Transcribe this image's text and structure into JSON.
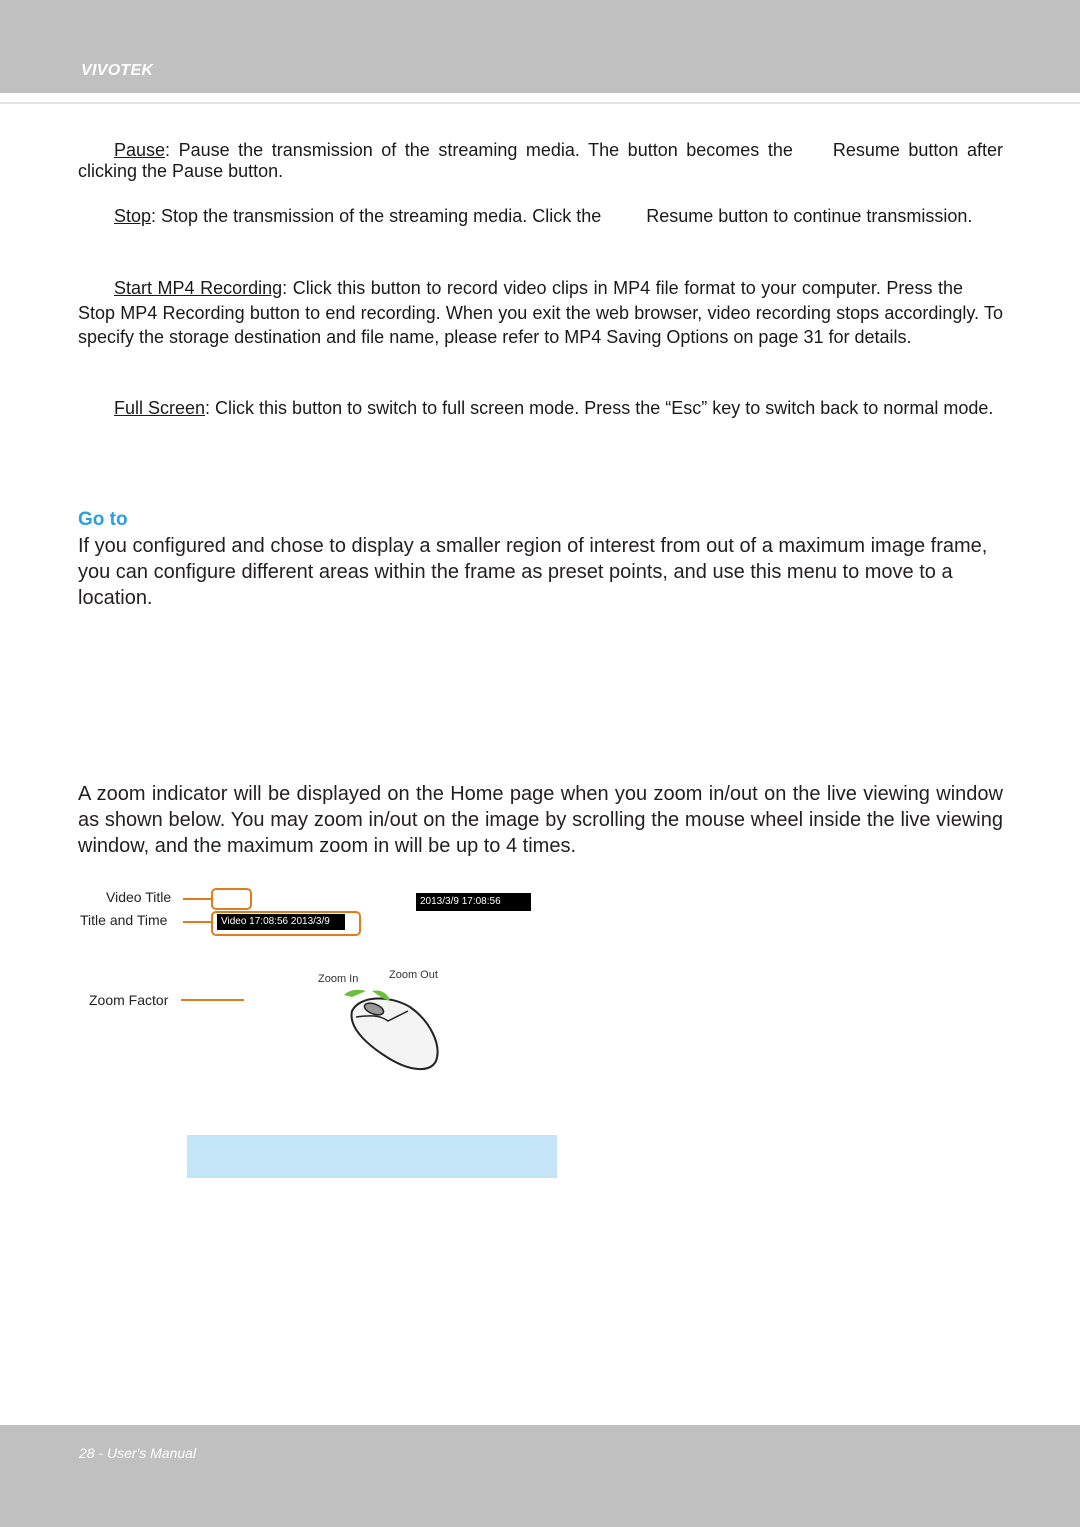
{
  "header": {
    "brand": "VIVOTEK"
  },
  "items": [
    {
      "term": "Pause",
      "text_a": ": Pause the transmission of the streaming media. The button becomes the",
      "text_b": "Resume button after clicking the Pause button."
    },
    {
      "term": "Stop",
      "text_a": ": Stop the transmission of the streaming media. Click the",
      "text_b": "Resume button to continue transmission."
    },
    {
      "term": "Start MP4 Recording",
      "text_a": ": Click this button to record video clips in MP4 file format to your computer. Press the",
      "text_b": "Stop MP4 Recording button to end recording. When you exit the web browser, video recording stops accordingly. To specify the storage destination and file name, please refer to MP4 Saving Options on page 31 for details."
    },
    {
      "term": "Full Screen",
      "text_a": ": Click this button to switch to full screen mode. Press the “Esc” key to switch back to normal mode."
    }
  ],
  "goto": {
    "heading": "Go to",
    "body": "If you configured and chose to display a smaller region of interest from out of a maximum image frame, you can configure different areas within the frame as preset points, and use this menu to move to a location."
  },
  "zoom_para": "A zoom indicator will be displayed on the Home page when you zoom in/out on the live viewing window as shown below. You may zoom in/out on the image by scrolling the mouse wheel inside the live viewing window, and the maximum zoom in will be up to 4 times.",
  "figure": {
    "labels": {
      "video_title": "Video Title",
      "title_and_time": "Title and Time",
      "zoom_factor": "Zoom Factor"
    },
    "title_time_overlay": "Video 17:08:56  2013/3/9",
    "time_overlay": "2013/3/9  17:08:56",
    "mouse": {
      "zoom_in": "Zoom In",
      "zoom_out": "Zoom Out"
    },
    "accent_color": "#e07b1e",
    "arrow_color": "#6cbf3c"
  },
  "footer": {
    "text": "28 - User's Manual"
  }
}
